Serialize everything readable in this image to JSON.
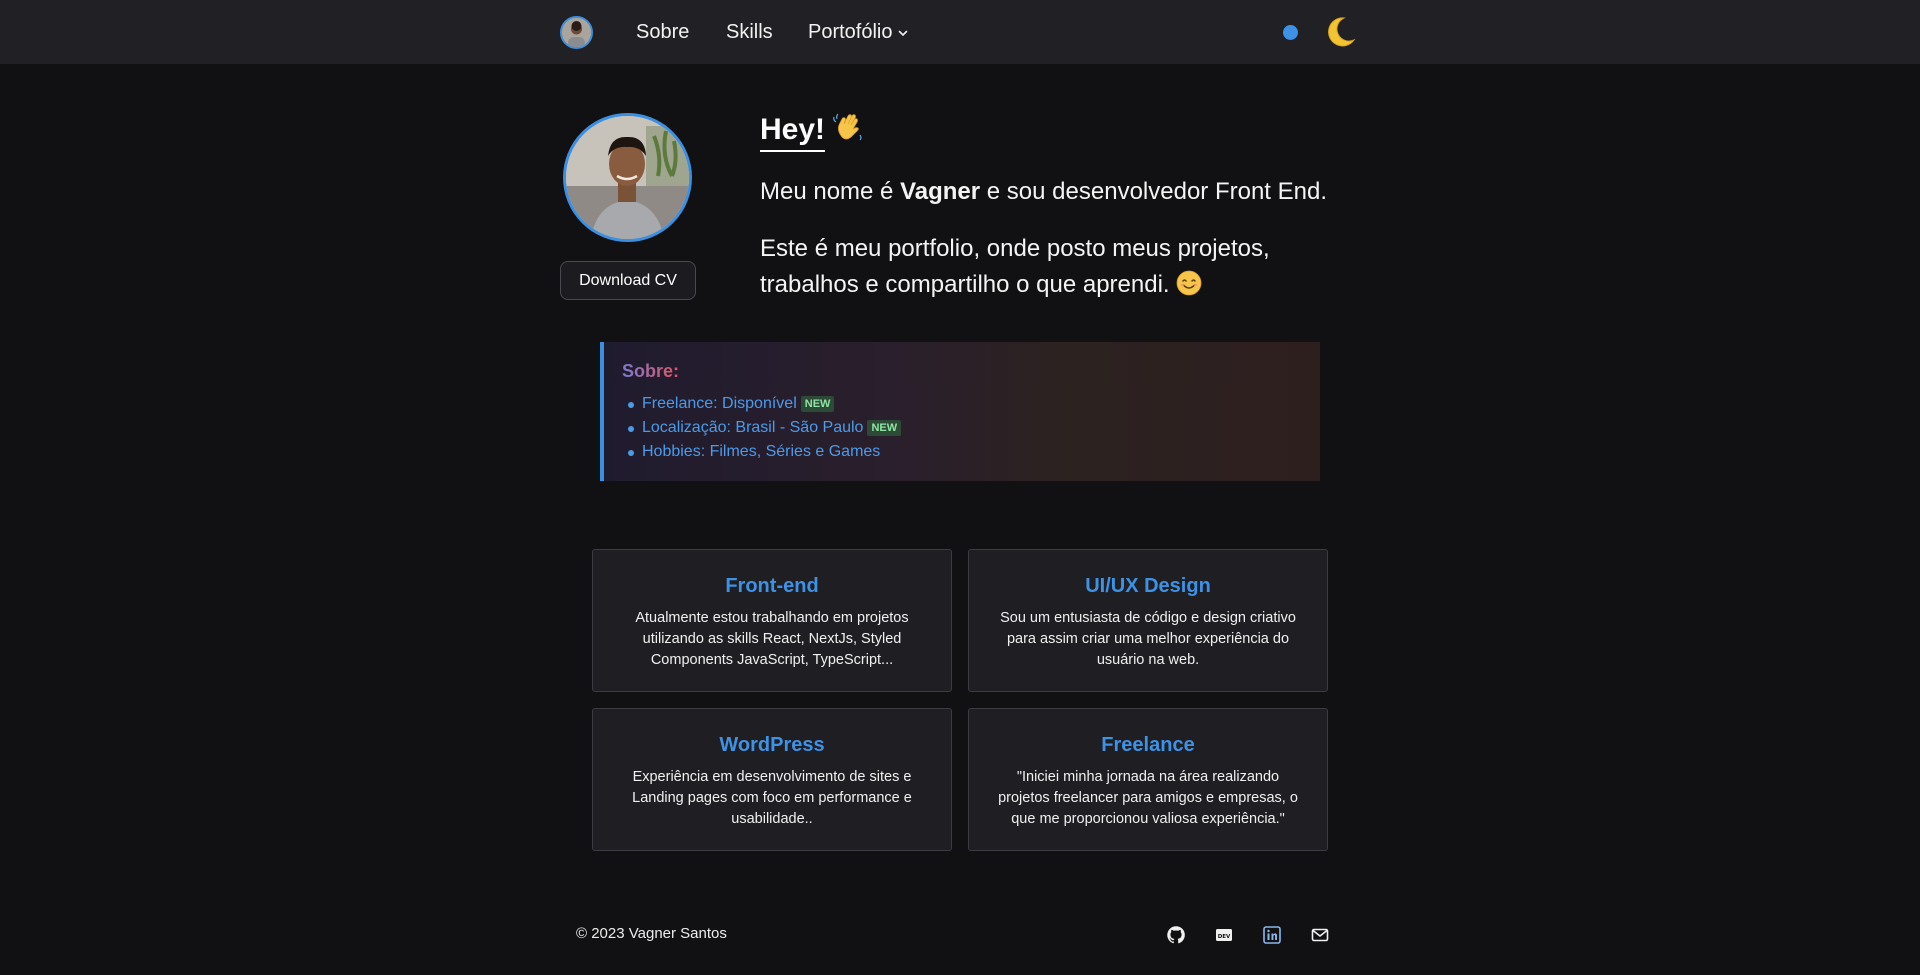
{
  "nav": {
    "links": [
      {
        "label": "Sobre"
      },
      {
        "label": "Skills"
      },
      {
        "label": "Portofólio"
      }
    ],
    "theme_icon": "moon-icon",
    "status_color": "#3d92e6"
  },
  "intro": {
    "greeting": "Hey!",
    "line1_prefix": "Meu nome é ",
    "name": "Vagner",
    "line1_suffix": " e sou desenvolvedor Front End.",
    "line2": "Este é meu portfolio, onde posto meus projetos, trabalhos e compartilho o que aprendi.",
    "download_label": "Download CV"
  },
  "about": {
    "title": "Sobre:",
    "items": [
      {
        "text": "Freelance: Disponível",
        "badge": "NEW"
      },
      {
        "text": "Localização: Brasil - São Paulo",
        "badge": "NEW"
      },
      {
        "text": "Hobbies: Filmes, Séries e Games"
      }
    ]
  },
  "cards": [
    {
      "title": "Front-end",
      "text": "Atualmente estou trabalhando em projetos utilizando as skills React, NextJs, Styled Components JavaScript, TypeScript..."
    },
    {
      "title": "UI/UX Design",
      "text": "Sou um entusiasta de código e design criativo para assim criar uma melhor experiência do usuário na web."
    },
    {
      "title": "WordPress",
      "text": "Experiência em desenvolvimento de sites e Landing pages com foco em performance e usabilidade.."
    },
    {
      "title": "Freelance",
      "text": "\"Iniciei minha jornada na área realizando projetos freelancer para amigos e empresas, o que me proporcionou valiosa experiência.\""
    }
  ],
  "footer": {
    "copyright": "© 2023 Vagner Santos",
    "socials": [
      "github-icon",
      "dev-icon",
      "linkedin-icon",
      "mail-icon"
    ]
  },
  "colors": {
    "accent": "#3d92e6",
    "background": "#111013",
    "header": "#212025",
    "card": "#1f1e23"
  }
}
